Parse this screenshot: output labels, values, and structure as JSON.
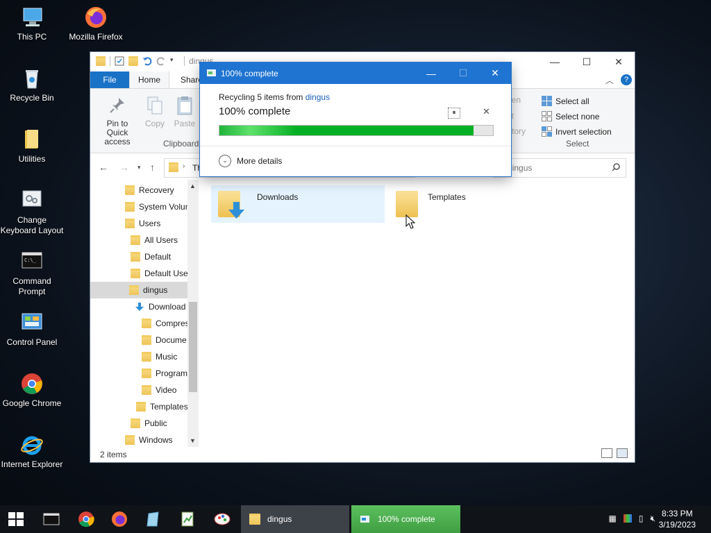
{
  "desktop": {
    "icons": [
      {
        "label": "This PC"
      },
      {
        "label": "Mozilla Firefox"
      },
      {
        "label": "Recycle Bin"
      },
      {
        "label": "Utilities"
      },
      {
        "label": "Change Keyboard Layout"
      },
      {
        "label": "Command Prompt"
      },
      {
        "label": "Control Panel"
      },
      {
        "label": "Google Chrome"
      },
      {
        "label": "Internet Explorer"
      }
    ]
  },
  "explorer": {
    "title": "dingus",
    "tabs": {
      "file": "File",
      "home": "Home",
      "share": "Share"
    },
    "ribbon": {
      "pin": "Pin to Quick access",
      "copy": "Copy",
      "paste": "Paste",
      "clipboard_group": "Clipboard",
      "open_partial": "pen",
      "edit_partial": "it",
      "history_partial": "story",
      "select_all": "Select all",
      "select_none": "Select none",
      "invert_selection": "Invert selection",
      "select_group": "Select"
    },
    "address_partial": "Th",
    "search_placeholder": "h dingus",
    "tree": [
      {
        "label": "Recovery"
      },
      {
        "label": "System Volun"
      },
      {
        "label": "Users"
      },
      {
        "label": "All Users"
      },
      {
        "label": "Default"
      },
      {
        "label": "Default User"
      },
      {
        "label": "dingus"
      },
      {
        "label": "Download"
      },
      {
        "label": "Compres"
      },
      {
        "label": "Docume"
      },
      {
        "label": "Music"
      },
      {
        "label": "Program"
      },
      {
        "label": "Video"
      },
      {
        "label": "Templates"
      },
      {
        "label": "Public"
      },
      {
        "label": "Windows"
      }
    ],
    "items": [
      {
        "name": "Downloads"
      },
      {
        "name": "Templates"
      }
    ],
    "status": "2 items"
  },
  "dialog": {
    "title": "100% complete",
    "recycling_text": "Recycling 5 items from ",
    "recycling_link": "dingus",
    "percent_text": "100% complete",
    "progress": 0.93,
    "more_details": "More details"
  },
  "taskbar": {
    "task_explorer": "dingus",
    "task_progress": "100% complete",
    "time": "8:33 PM",
    "date": "3/19/2023"
  }
}
